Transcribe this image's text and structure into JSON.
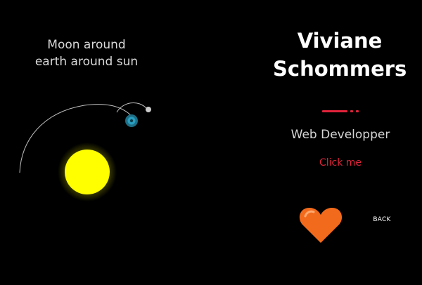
{
  "caption": {
    "line1": "Moon around",
    "line2": "earth around sun"
  },
  "profile": {
    "first_name": "Viviane",
    "last_name": "Schommers",
    "role": "Web Developper",
    "cta_label": "Click me",
    "back_label": "BACK"
  },
  "colors": {
    "background": "#000000",
    "accent": "#e0233a",
    "heart": "#f26a1b",
    "sun": "#ffff00",
    "earth": "#1e6f86",
    "moon": "#cccccc"
  },
  "icons": {
    "heart": "heart-icon",
    "sun": "sun-icon",
    "earth": "earth-icon",
    "moon": "moon-icon"
  }
}
